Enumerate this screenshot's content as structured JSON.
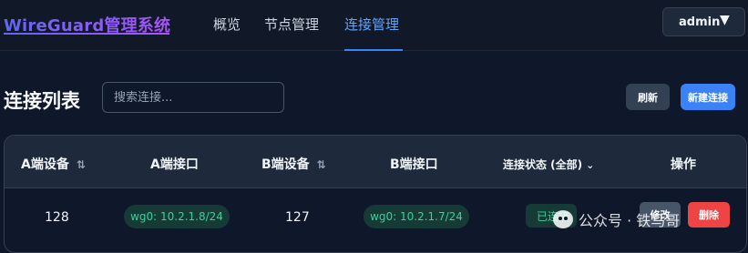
{
  "header": {
    "brand": "WireGuard管理系统",
    "nav": [
      "概览",
      "节点管理",
      "连接管理"
    ],
    "active_nav": "连接管理",
    "user": "admin",
    "user_caret": "▼"
  },
  "page": {
    "title": "连接列表",
    "search_placeholder": "搜索连接...",
    "refresh_label": "刷新",
    "new_label": "新建连接"
  },
  "table": {
    "columns": [
      "A端设备",
      "A端接口",
      "B端设备",
      "B端接口",
      "连接状态 (全部)",
      "操作"
    ],
    "sort_icon": "⇅",
    "filter_icon": "⌄",
    "rows": [
      {
        "a_device": "128",
        "a_interface": "wg0: 10.2.1.8/24",
        "b_device": "127",
        "b_interface": "wg0: 10.2.1.7/24",
        "status": "已连接",
        "edit": "修改",
        "delete": "删除"
      }
    ]
  },
  "watermark": "公众号 · 铁马哥"
}
